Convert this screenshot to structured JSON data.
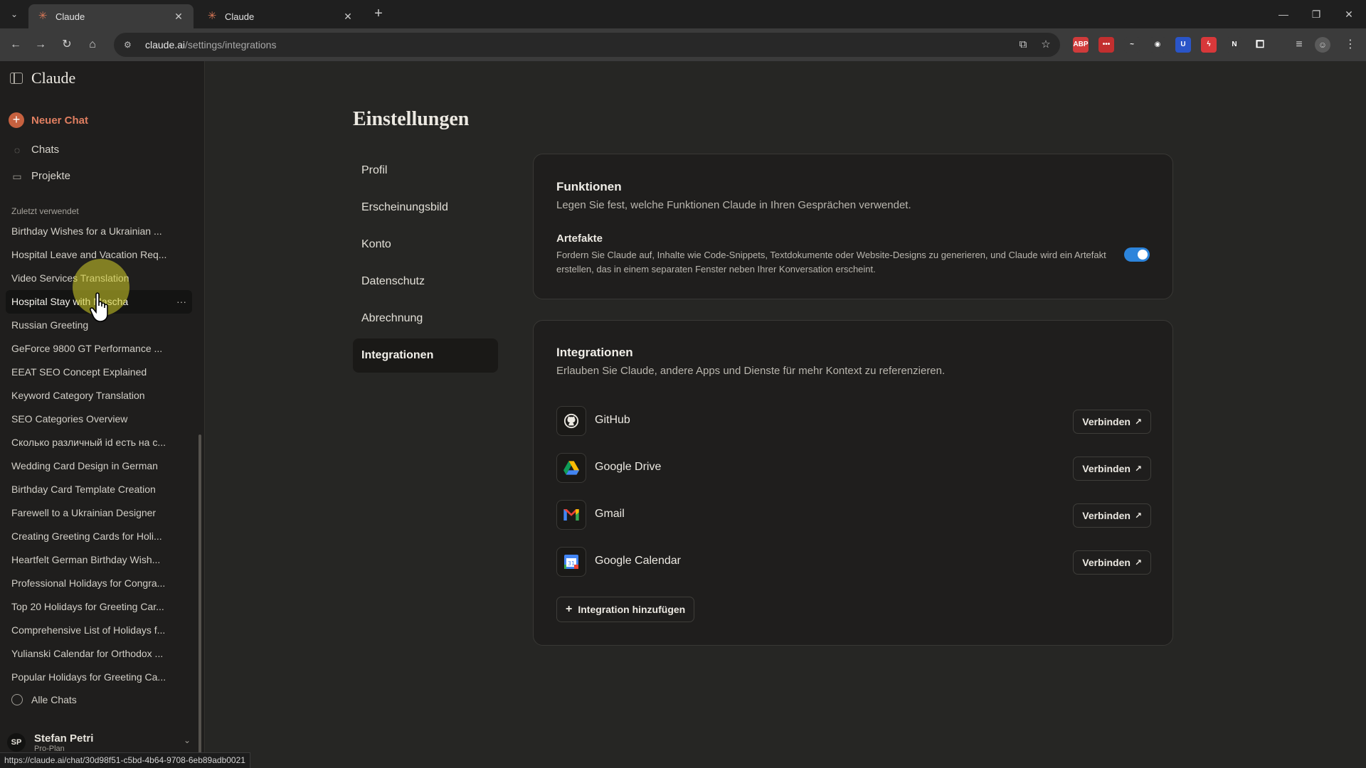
{
  "browser": {
    "tabs": [
      {
        "title": "Claude",
        "active": true
      },
      {
        "title": "Claude",
        "active": false
      }
    ],
    "url_host": "claude.ai",
    "url_path": "/settings/integrations",
    "extensions": [
      {
        "name": "abp-icon",
        "label": "ABP",
        "color": "#d03b3b"
      },
      {
        "name": "ext-red-icon",
        "label": "•••",
        "color": "#c22f2f"
      },
      {
        "name": "ext-wave-icon",
        "label": "~",
        "color": "#3b3b3b"
      },
      {
        "name": "camera-icon",
        "label": "◉",
        "color": "#3b3b3b"
      },
      {
        "name": "bitwarden-icon",
        "label": "U",
        "color": "#2a55c8"
      },
      {
        "name": "ext-flash-icon",
        "label": "ϟ",
        "color": "#d8383a"
      },
      {
        "name": "notion-icon",
        "label": "N",
        "color": "#3b3b3b"
      }
    ]
  },
  "sidebar": {
    "brand": "Claude",
    "new_chat": "Neuer Chat",
    "nav": [
      {
        "label": "Chats",
        "icon": "chat-icon"
      },
      {
        "label": "Projekte",
        "icon": "folder-icon"
      }
    ],
    "recent_heading": "Zuletzt verwendet",
    "recent": [
      "Birthday Wishes for a Ukrainian ...",
      "Hospital Leave and Vacation Req...",
      "Video Services Translation",
      "Hospital Stay with Mascha",
      "Russian Greeting",
      "GeForce 9800 GT Performance ...",
      "EEAT SEO Concept Explained",
      "Keyword Category Translation",
      "SEO Categories Overview",
      "Сколько различный id есть на с...",
      "Wedding Card Design in German",
      "Birthday Card Template Creation",
      "Farewell to a Ukrainian Designer",
      "Creating Greeting Cards for Holi...",
      "Heartfelt German Birthday Wish...",
      "Professional Holidays for Congra...",
      "Top 20 Holidays for Greeting Car...",
      "Comprehensive List of Holidays f...",
      "Yulianski Calendar for Orthodox ...",
      "Popular Holidays for Greeting Ca..."
    ],
    "active_recent_index": 3,
    "more_label": "···",
    "all_chats": "Alle Chats",
    "user": {
      "initials": "SP",
      "name": "Stefan Petri",
      "plan": "Pro-Plan"
    }
  },
  "status_url": "https://claude.ai/chat/30d98f51-c5bd-4b64-9708-6eb89adb0021",
  "settings": {
    "title": "Einstellungen",
    "nav": [
      "Profil",
      "Erscheinungsbild",
      "Konto",
      "Datenschutz",
      "Abrechnung",
      "Integrationen"
    ],
    "active_nav": "Integrationen",
    "functions": {
      "title": "Funktionen",
      "subtitle": "Legen Sie fest, welche Funktionen Claude in Ihren Gesprächen verwendet.",
      "feature_title": "Artefakte",
      "feature_desc": "Fordern Sie Claude auf, Inhalte wie Code-Snippets, Textdokumente oder Website-Designs zu generieren, und Claude wird ein Artefakt erstellen, das in einem separaten Fenster neben Ihrer Konversation erscheint.",
      "feature_enabled": true
    },
    "integrations": {
      "title": "Integrationen",
      "subtitle": "Erlauben Sie Claude, andere Apps und Dienste für mehr Kontext zu referenzieren.",
      "items": [
        {
          "name": "GitHub",
          "icon": "github-icon",
          "button": "Verbinden"
        },
        {
          "name": "Google Drive",
          "icon": "google-drive-icon",
          "button": "Verbinden"
        },
        {
          "name": "Gmail",
          "icon": "gmail-icon",
          "button": "Verbinden"
        },
        {
          "name": "Google Calendar",
          "icon": "google-calendar-icon",
          "button": "Verbinden"
        }
      ],
      "add_button": "Integration hinzufügen"
    }
  },
  "colors": {
    "accent": "#c6613f",
    "toggle_on": "#2c84db"
  }
}
